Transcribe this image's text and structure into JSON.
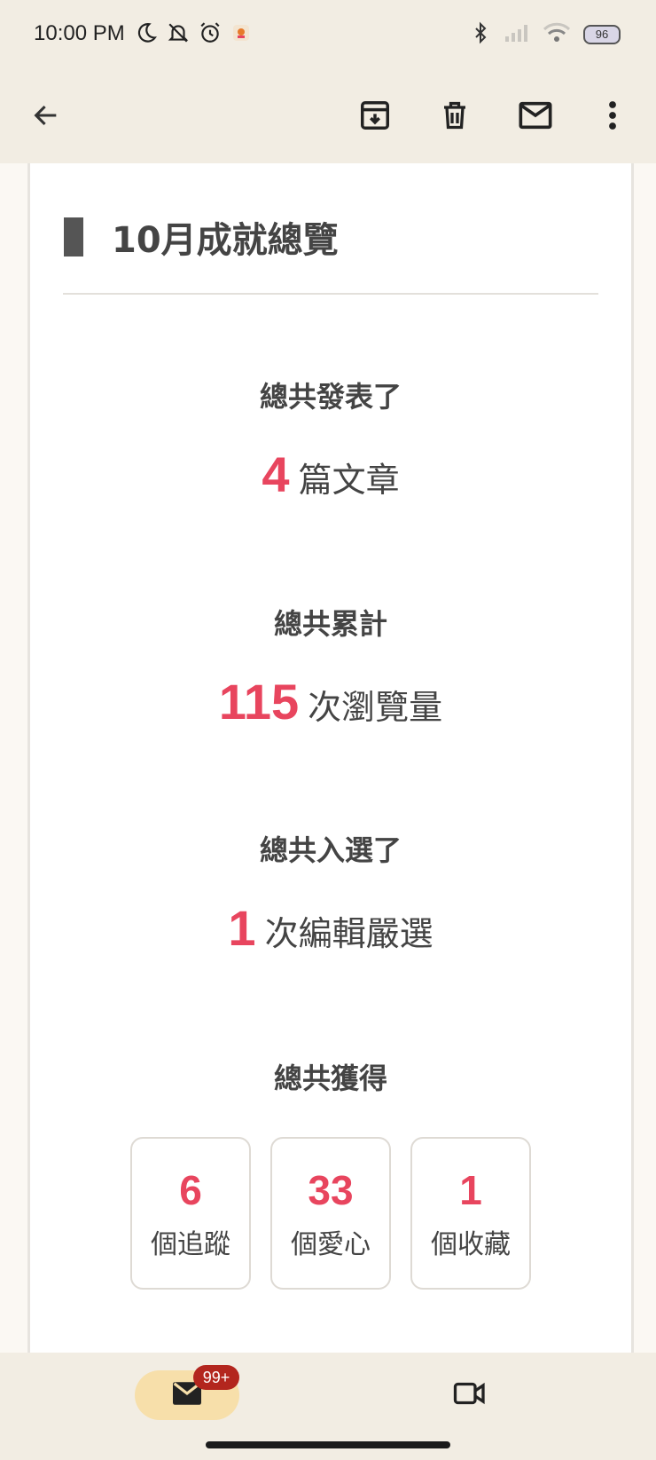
{
  "status_bar": {
    "time": "10:00 PM",
    "battery": "96",
    "icons_left": [
      "moon-icon",
      "bell-off-icon",
      "alarm-icon",
      "app-notification-icon"
    ],
    "icons_right": [
      "bluetooth-icon",
      "signal-icon",
      "wifi-icon",
      "battery-icon"
    ]
  },
  "app_bar": {
    "icons": [
      "back-arrow-icon",
      "archive-icon",
      "trash-icon",
      "mail-icon",
      "more-vert-icon"
    ]
  },
  "article": {
    "heading": "10月成就總覽",
    "stats": [
      {
        "label": "總共發表了",
        "number": "4",
        "unit": "篇文章"
      },
      {
        "label": "總共累計",
        "number": "115",
        "unit": "次瀏覽量"
      },
      {
        "label": "總共入選了",
        "number": "1",
        "unit": "次編輯嚴選"
      }
    ],
    "gained_label": "總共獲得",
    "boxes": [
      {
        "number": "6",
        "unit": "個追蹤"
      },
      {
        "number": "33",
        "unit": "個愛心"
      },
      {
        "number": "1",
        "unit": "個收藏"
      }
    ]
  },
  "bottom_nav": {
    "mail_badge": "99+",
    "icons": [
      "mail-icon",
      "video-icon"
    ]
  },
  "colors": {
    "accent": "#e8455e",
    "bar_bg": "#f2ede3",
    "pill": "#f7dfaa",
    "badge": "#b3261e"
  }
}
